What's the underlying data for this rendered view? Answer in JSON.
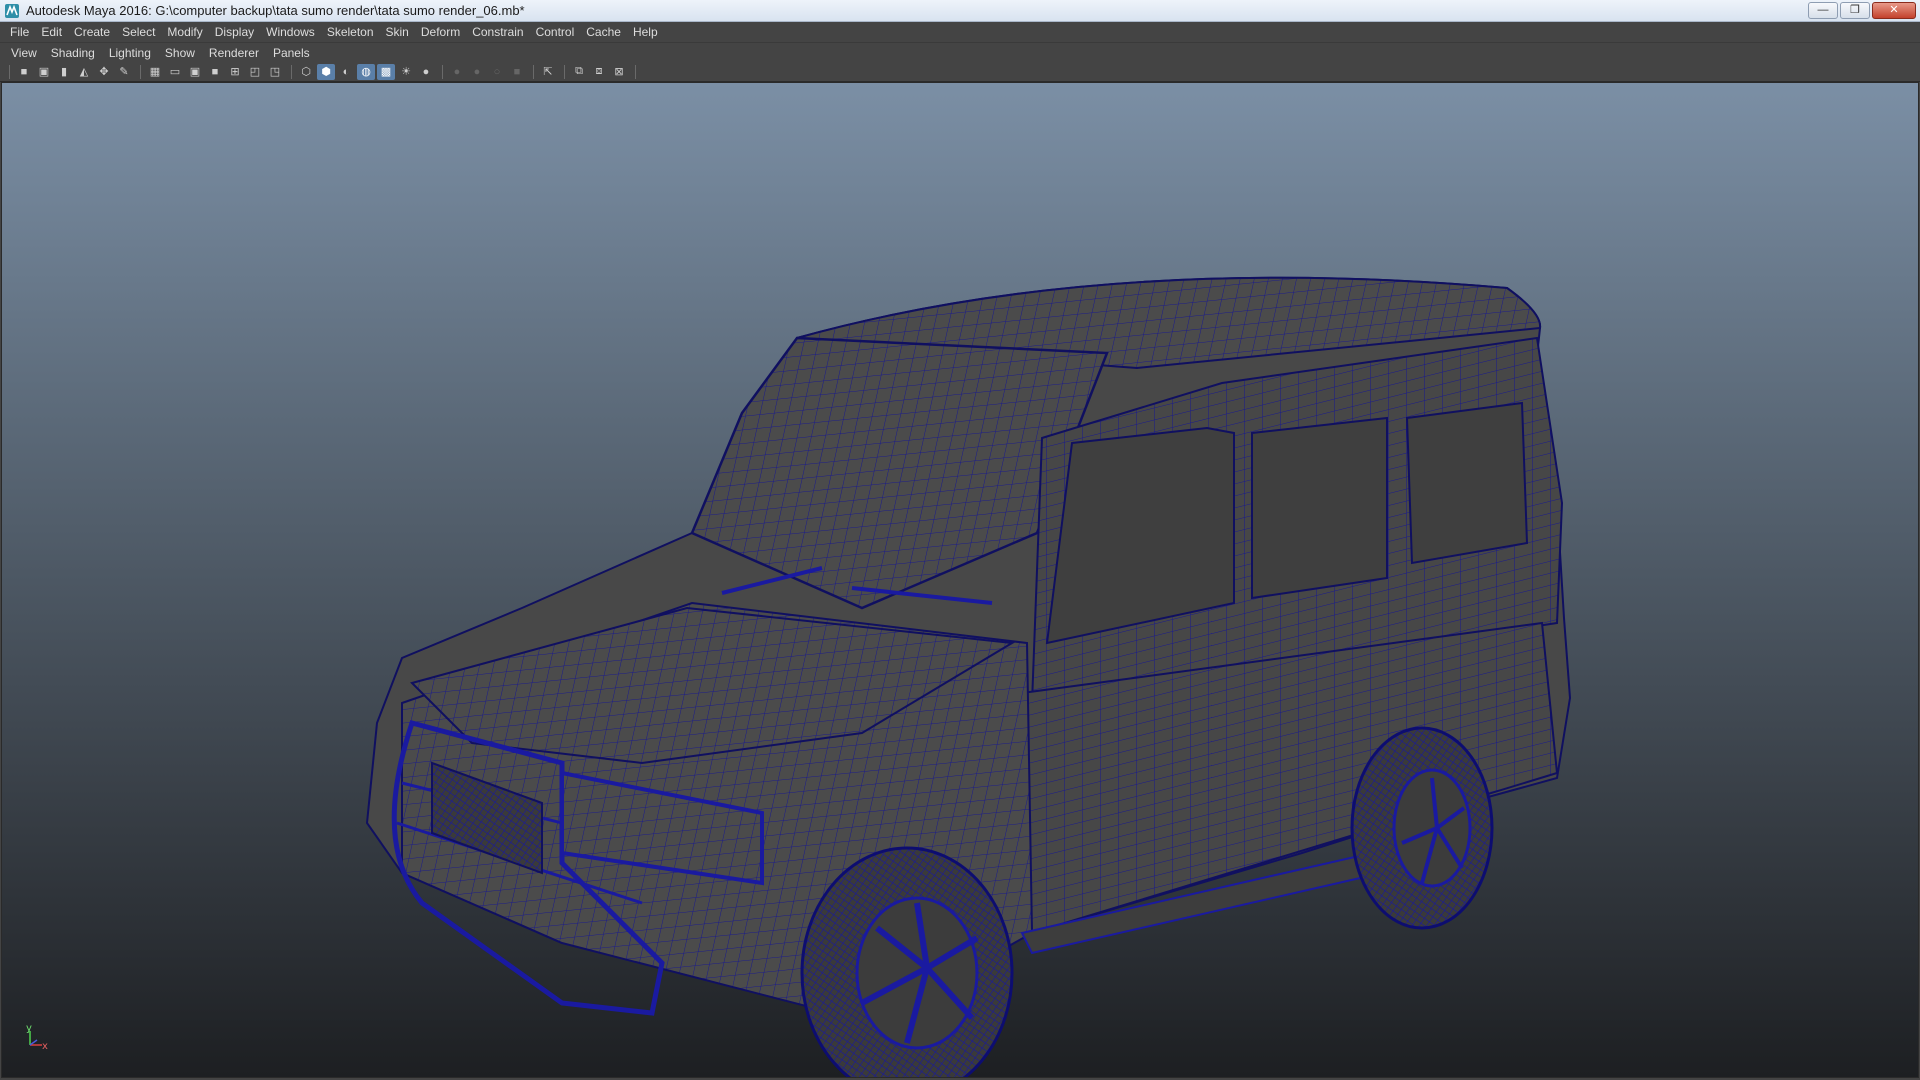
{
  "window": {
    "title": "Autodesk Maya 2016: G:\\computer backup\\tata sumo render\\tata sumo render_06.mb*",
    "icon": "maya-app-icon",
    "controls": {
      "minimize": "—",
      "maximize": "❐",
      "close": "✕"
    }
  },
  "menubar": {
    "items": [
      "File",
      "Edit",
      "Create",
      "Select",
      "Modify",
      "Display",
      "Windows",
      "Skeleton",
      "Skin",
      "Deform",
      "Constrain",
      "Control",
      "Cache",
      "Help"
    ]
  },
  "panelbar": {
    "items": [
      "View",
      "Shading",
      "Lighting",
      "Show",
      "Renderer",
      "Panels"
    ]
  },
  "toolbar": {
    "icons": [
      "camera-icon",
      "camera-attributes-icon",
      "bookmark-icon",
      "image-plane-icon",
      "2d-pan-icon",
      "grease-pencil-icon",
      "grid-icon",
      "film-gate-icon",
      "resolution-gate-icon",
      "gate-mask-icon",
      "field-chart-icon",
      "safe-action-icon",
      "safe-title-icon",
      "wireframe-icon",
      "smooth-shade-icon",
      "shaded-wireframe-icon",
      "wireframe-on-shaded-icon",
      "textured-icon",
      "use-all-lights-icon",
      "shadows-icon",
      "ambient-occlusion-icon",
      "motion-blur-icon",
      "anti-alias-icon",
      "depth-of-field-icon",
      "isolate-select-icon",
      "xray-icon",
      "xray-joints-icon",
      "xray-components-icon"
    ],
    "active": [
      "smooth-shade-icon",
      "shaded-wireframe-icon",
      "wireframe-on-shaded-icon"
    ]
  },
  "viewport": {
    "subject": "vehicle-wireframe-model",
    "wire_color": "#1a1a8c",
    "surface_color": "#4a4a4a",
    "axis": {
      "y": "y",
      "x": "x"
    }
  }
}
